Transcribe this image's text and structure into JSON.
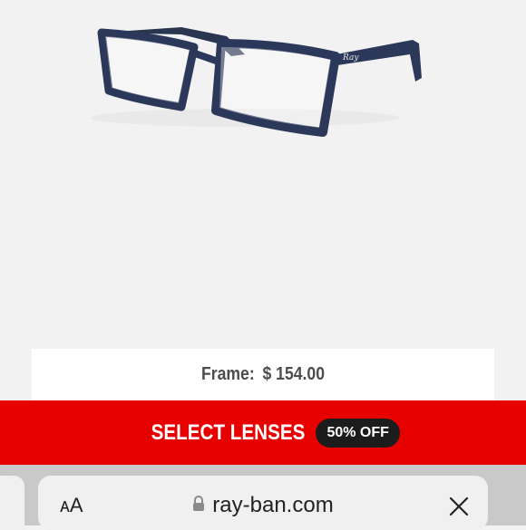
{
  "product": {
    "image": "eyeglasses-product-image",
    "frame_label": "Frame:",
    "price": "$ 154.00"
  },
  "cta": {
    "label": "SELECT LENSES",
    "badge": "50% OFF"
  },
  "browser": {
    "text_size_button": "ᴀA",
    "url": "ray-ban.com",
    "lock_icon": "lock-icon",
    "close_icon": "close-icon"
  },
  "colors": {
    "accent_red": "#e60000",
    "badge_bg": "#1c1c1c",
    "frame_color": "#2a3550"
  }
}
